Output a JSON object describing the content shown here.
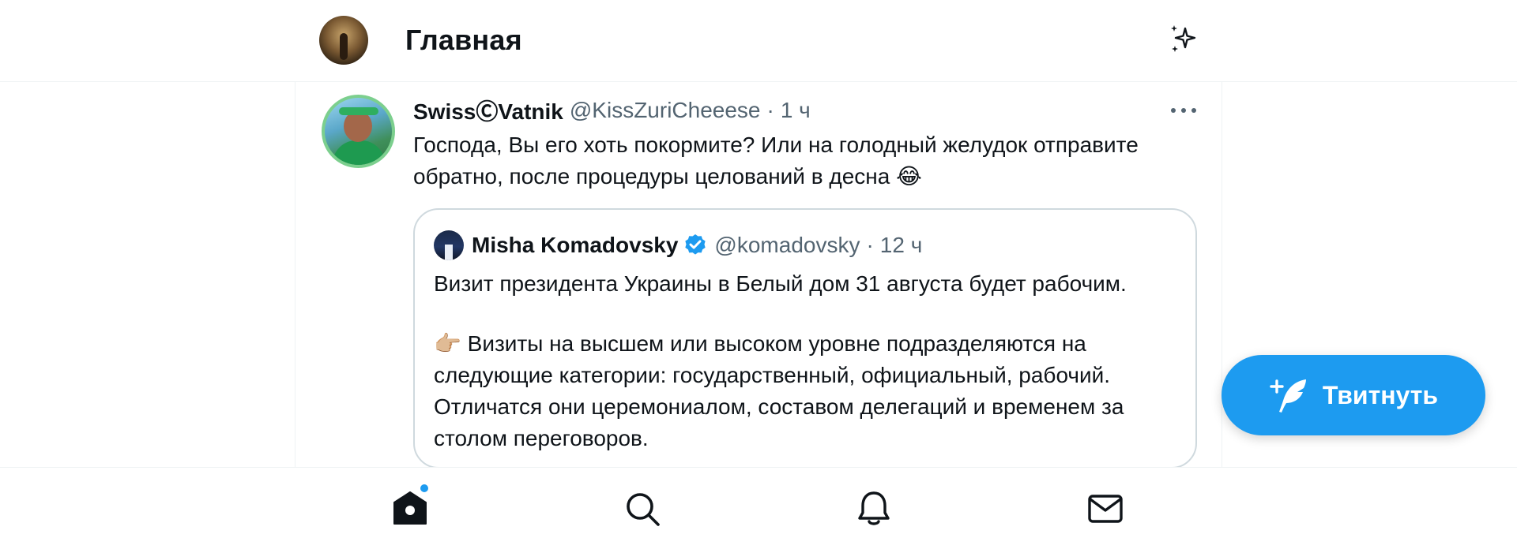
{
  "header": {
    "title": "Главная",
    "avatar_icon": "user-avatar-plague-mask",
    "sparkle_icon": "sparkle-icon"
  },
  "tweet": {
    "author_name": "SwissⒸVatnik",
    "author_handle": "@KissZuriCheeese",
    "separator": "·",
    "time": "1 ч",
    "text": "Господа, Вы его хоть покормите? Или на голодный желудок отправите обратно, после процедуры целований в десна 😂",
    "more_icon": "more-icon"
  },
  "quote": {
    "author_name": "Misha Komadovsky",
    "verified_icon": "verified-badge-icon",
    "author_handle": "@komadovsky",
    "separator": "·",
    "time": "12 ч",
    "paragraph_1": "Визит президента Украины в Белый дом 31 августа будет рабочим.",
    "paragraph_2": "👉🏼 Визиты на высшем или высоком уровне подразделяются на следующие категории: государственный, официальный, рабочий. Отличатся они церемониалом, составом делегаций и временем за столом переговоров."
  },
  "fab": {
    "label": "Твитнуть",
    "icon": "compose-feather-icon"
  },
  "bottom_nav": {
    "items": [
      "home-icon",
      "search-icon",
      "bell-icon",
      "mail-icon"
    ],
    "has_new_badge": true
  },
  "colors": {
    "accent": "#1d9bf0",
    "text": "#0f1419",
    "muted": "#536471",
    "border": "#cfd9de"
  }
}
